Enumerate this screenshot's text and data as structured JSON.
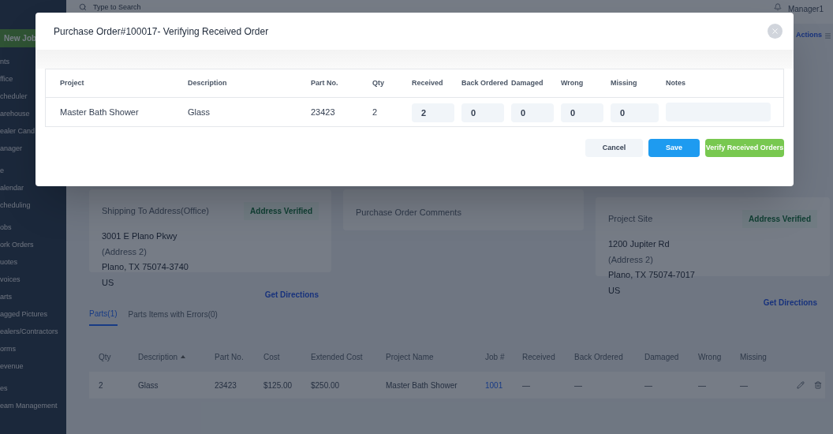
{
  "top_bar": {
    "search_placeholder": "Type to Search",
    "user": "Manager1"
  },
  "sidebar": {
    "new_job": "New Job",
    "groups": [
      [
        "nts",
        "ffice",
        "cheduler",
        "arehouse",
        "ealer Cand",
        "anager"
      ],
      [
        "e",
        "alendar",
        "cheduling"
      ],
      [
        "obs",
        "ork Orders",
        "uotes",
        "voices",
        "arts",
        "agged Pictures",
        "ealers/Contractors",
        "orms",
        "evenue"
      ],
      [
        "es",
        "eam Management"
      ]
    ]
  },
  "actions": "Actions",
  "shipping": {
    "title": "Shipping To Address(Office)",
    "badge": "Address Verified",
    "lines": [
      {
        "kind": "line",
        "text": "3001 E Plano Pkwy"
      },
      {
        "kind": "placeholder",
        "text": "(Address 2)"
      },
      {
        "kind": "line",
        "text": "Plano, TX 75074-3740"
      },
      {
        "kind": "line",
        "text": "US"
      }
    ],
    "link": "Get Directions"
  },
  "comments": {
    "title": "Purchase Order Comments"
  },
  "project_site": {
    "title": "Project Site",
    "badge": "Address Verified",
    "lines": [
      {
        "kind": "line",
        "text": "1200 Jupiter Rd"
      },
      {
        "kind": "placeholder",
        "text": "(Address 2)"
      },
      {
        "kind": "line",
        "text": "Plano, TX 75074-7017"
      },
      {
        "kind": "line",
        "text": "US"
      }
    ],
    "link": "Get Directions"
  },
  "tabs": [
    {
      "label": "Parts(1)",
      "selected": true
    },
    {
      "label": "Parts Items with Errors(0)",
      "selected": false
    }
  ],
  "parts_table": {
    "columns": [
      {
        "label": "Qty",
        "sorted": false
      },
      {
        "label": "Description",
        "sorted": true
      },
      {
        "label": "Part No.",
        "sorted": false
      },
      {
        "label": "Cost",
        "sorted": false
      },
      {
        "label": "Extended Cost",
        "sorted": false
      },
      {
        "label": "Project Name",
        "sorted": false
      },
      {
        "label": "Job #",
        "sorted": false
      },
      {
        "label": "Received",
        "sorted": false
      },
      {
        "label": "Back Ordered",
        "sorted": false
      },
      {
        "label": "Damaged",
        "sorted": false
      },
      {
        "label": "Wrong",
        "sorted": false
      },
      {
        "label": "Missing",
        "sorted": false
      }
    ],
    "rows": [
      {
        "cells": [
          {
            "kind": "text",
            "text": "2"
          },
          {
            "kind": "text",
            "text": "Glass"
          },
          {
            "kind": "text",
            "text": "23423"
          },
          {
            "kind": "text",
            "text": "$125.00"
          },
          {
            "kind": "text",
            "text": "$250.00"
          },
          {
            "kind": "text",
            "text": "Master Bath Shower"
          },
          {
            "kind": "link",
            "text": "1001"
          },
          {
            "kind": "text",
            "text": "—"
          },
          {
            "kind": "text",
            "text": "—"
          },
          {
            "kind": "text",
            "text": "—"
          },
          {
            "kind": "text",
            "text": "—"
          },
          {
            "kind": "text",
            "text": "—"
          }
        ]
      }
    ]
  },
  "modal": {
    "title": "Purchase Order#100017- Verifying Received Order",
    "columns": [
      "Project",
      "Description",
      "Part No.",
      "Qty",
      "Received",
      "Back Ordered",
      "Damaged",
      "Wrong",
      "Missing",
      "Notes"
    ],
    "rows": [
      {
        "cells": [
          {
            "kind": "text",
            "text": "Master Bath Shower"
          },
          {
            "kind": "text",
            "text": "Glass"
          },
          {
            "kind": "text",
            "text": "23423"
          },
          {
            "kind": "text",
            "text": "2"
          },
          {
            "kind": "input",
            "text": "2"
          },
          {
            "kind": "input",
            "text": "0"
          },
          {
            "kind": "input",
            "text": "0"
          },
          {
            "kind": "input",
            "text": "0"
          },
          {
            "kind": "input",
            "text": "0"
          },
          {
            "kind": "notes"
          }
        ]
      }
    ],
    "buttons": [
      {
        "kind": "cancel",
        "label": "Cancel"
      },
      {
        "kind": "save",
        "label": "Save"
      },
      {
        "kind": "verify",
        "label": "Verify Received Orders"
      }
    ]
  }
}
